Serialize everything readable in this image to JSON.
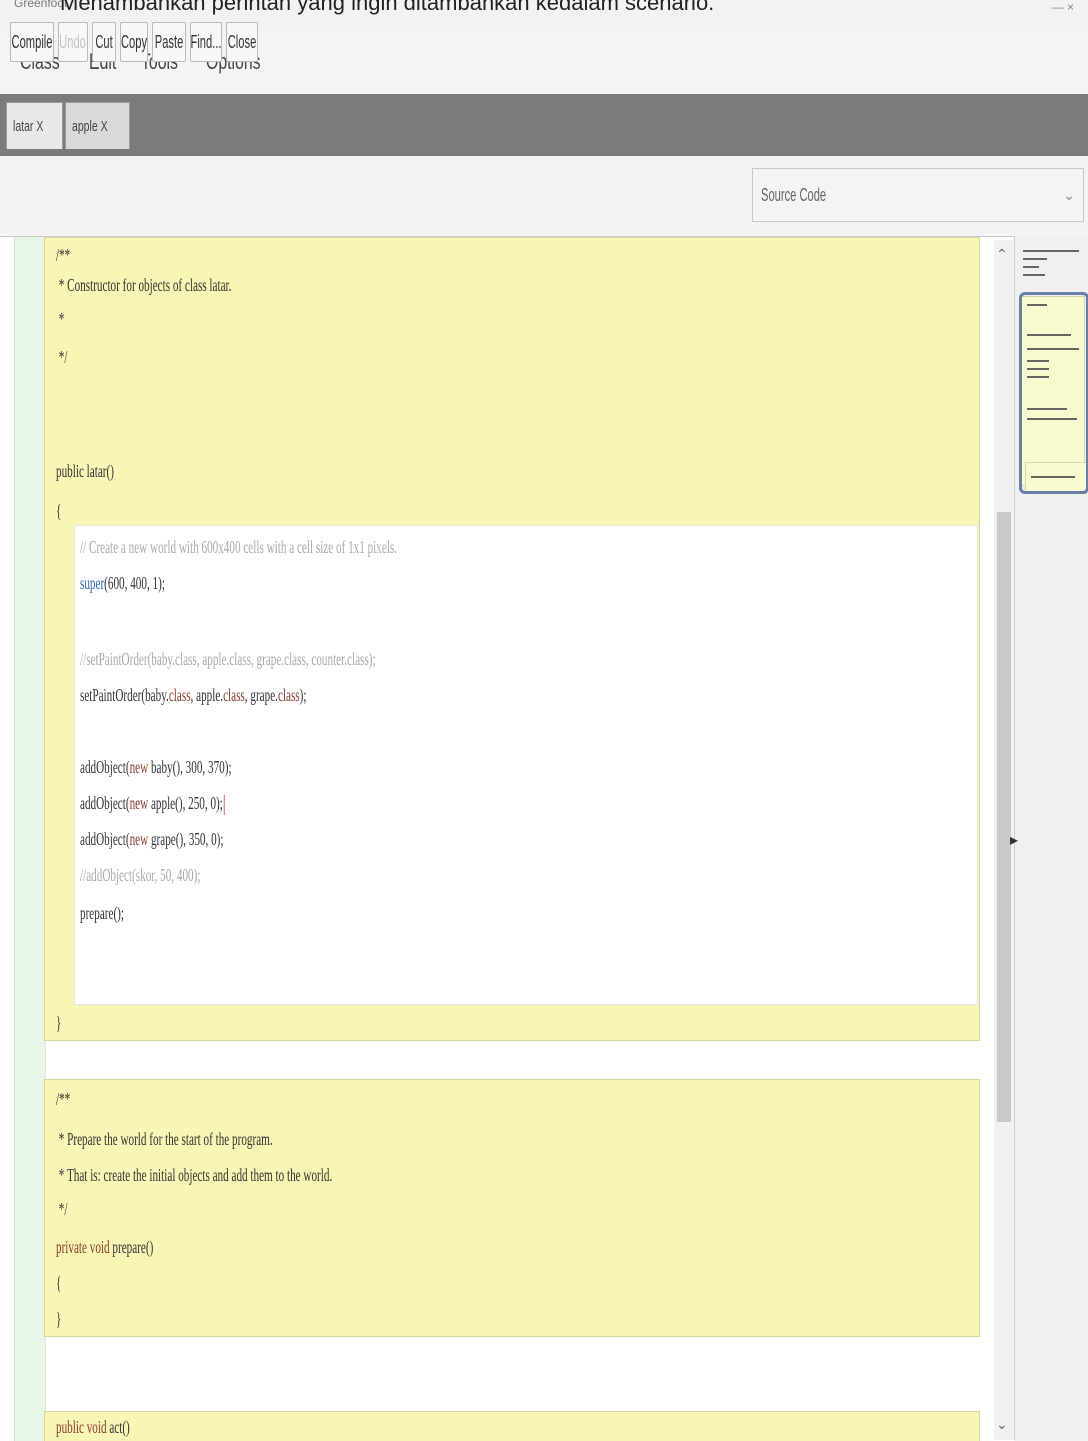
{
  "document_caption": "Menambahkan perintah yang ingin ditambahkan kedalam scenario.",
  "window_title_fragment": "Greenfoot",
  "menu": [
    "Class",
    "Edit",
    "Tools",
    "Options"
  ],
  "tabs": [
    {
      "label": "latar X",
      "active": true
    },
    {
      "label": "apple X",
      "active": false
    }
  ],
  "toolbar": {
    "compile": "Compile",
    "undo": "Undo",
    "cut": "Cut",
    "copy": "Copy",
    "paste": "Paste",
    "find": "Find...",
    "close": "Close"
  },
  "view_select": {
    "value": "Source Code"
  },
  "code": {
    "c1": "/**",
    "c2": " * Constructor for objects of class latar.",
    "c3": " *",
    "c4": " */",
    "sig1": "public latar()",
    "brace_open": "{",
    "l1": "// Create a new world with 600x400 cells with a cell size of 1x1 pixels.",
    "l2_kw": "super",
    "l2_rest": "(600, 400, 1);",
    "l3": "//setPaintOrder(baby.class, apple.class, grape.class, counter.class);",
    "l4_a": "setPaintOrder(baby.",
    "l4_b": "class",
    "l4_c": ", apple.",
    "l4_d": "class",
    "l4_e": ", grape.",
    "l4_f": "class",
    "l4_g": ");",
    "l5_a": "addObject(",
    "l5_kw": "new",
    "l5_b": " baby(), 300, 370);",
    "l6_a": "addObject(",
    "l6_kw": "new",
    "l6_b": " apple(), 250, 0);",
    "l7_a": "addObject(",
    "l7_kw": "new",
    "l7_b": " grape(), 350, 0);",
    "l8": "//addObject(skor, 50, 400);",
    "l9": "prepare();",
    "brace_close": "}",
    "d1": "/**",
    "d2": " * Prepare the world for the start of the program.",
    "d3": " * That is: create the initial objects and add them to the world.",
    "d4": " */",
    "sig2_kw": "private",
    "sig2_void": "void",
    "sig2_rest": " prepare()",
    "b2_open": "{",
    "b2_close": "}",
    "sig3_kw": "public",
    "sig3_void": "void",
    "sig3_rest": " act()"
  }
}
